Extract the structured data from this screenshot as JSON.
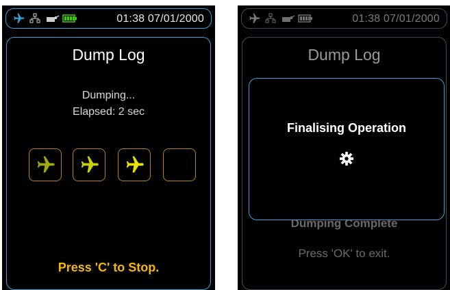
{
  "left_screen": {
    "status_bar": {
      "time": "01:38 07/01/2000",
      "icons": [
        "airplane-icon",
        "network-icon",
        "plug-icon",
        "battery-icon"
      ],
      "accent": "#2ea6dc",
      "battery_color": "#39d200"
    },
    "title": "Dump Log",
    "status_line": "Dumping...",
    "elapsed_line": "Elapsed: 2 sec",
    "progress": {
      "filled_tiles": 3,
      "total_tiles": 4
    },
    "hint": "Press 'C' to Stop.",
    "hint_color": "#f5b800"
  },
  "right_screen": {
    "status_bar": {
      "time": "01:38 07/01/2000",
      "icons": [
        "airplane-icon",
        "network-icon",
        "plug-icon",
        "battery-icon"
      ]
    },
    "title": "Dump Log",
    "background_status": "Dumping Complete",
    "background_hint": "Press 'OK' to exit.",
    "dialog": {
      "title": "Finalising Operation",
      "icon": "gear-icon"
    }
  }
}
